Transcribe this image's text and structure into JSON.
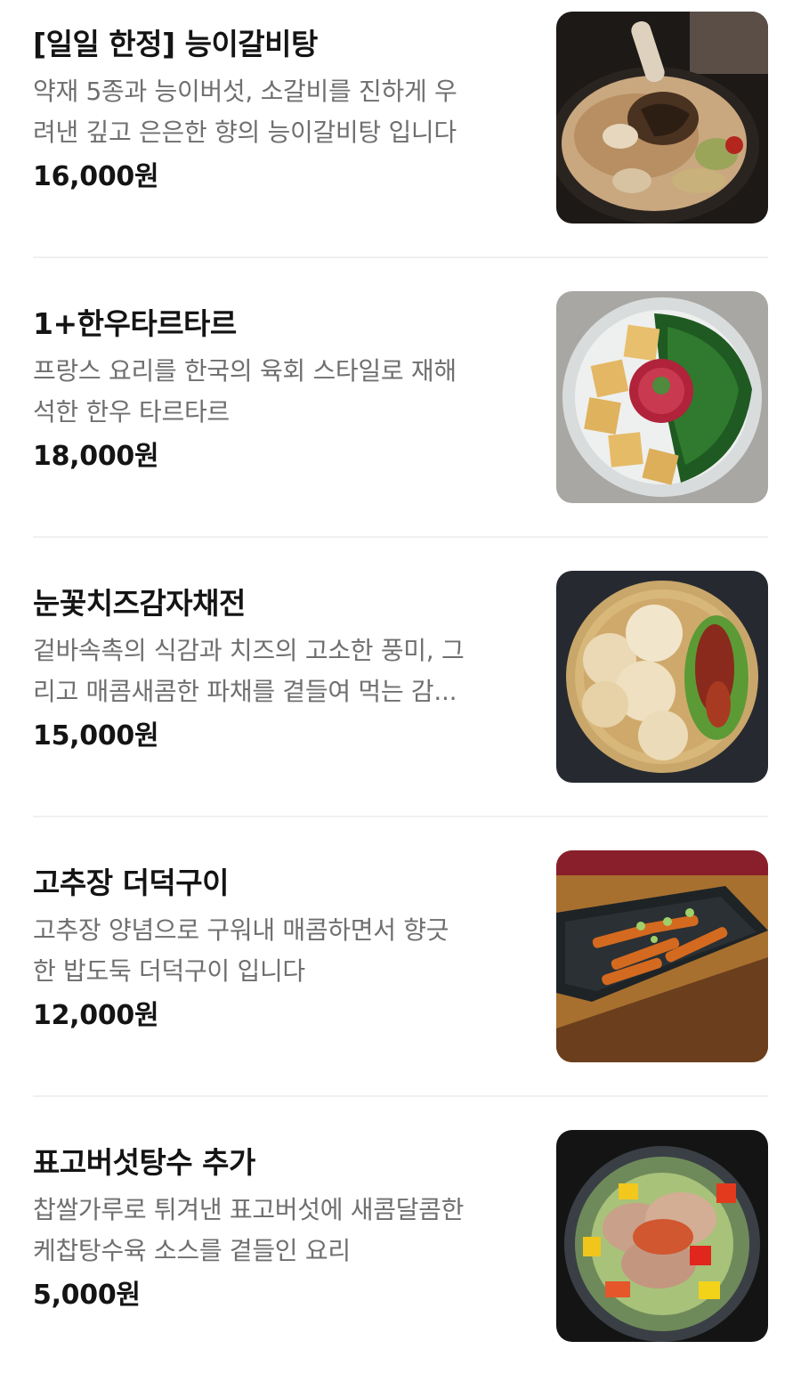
{
  "menu": {
    "items": [
      {
        "name": "[일일 한정] 능이갈비탕",
        "desc_lines": [
          "약재 5종과 능이버섯, 소갈비를 진하게 우",
          "려낸 깊고 은은한 향의 능이갈비탕 입니다"
        ],
        "price": "16,000원",
        "photo": "beef-rib-soup-photo"
      },
      {
        "name": "1+한우타르타르",
        "desc_lines": [
          "프랑스 요리를 한국의 육회 스타일로 재해",
          "석한 한우 타르타르"
        ],
        "price": "18,000원",
        "photo": "beef-tartare-photo"
      },
      {
        "name": "눈꽃치즈감자채전",
        "desc_lines": [
          "겉바속촉의 식감과 치즈의 고소한 풍미, 그",
          "리고 매콤새콤한 파채를 곁들여 먹는 감..."
        ],
        "price": "15,000원",
        "photo": "cheese-potato-pancake-photo"
      },
      {
        "name": "고추장 더덕구이",
        "desc_lines": [
          "고추장 양념으로 구워내 매콤하면서 향긋",
          "한 밥도둑 더덕구이 입니다"
        ],
        "price": "12,000원",
        "photo": "grilled-deodeok-photo"
      },
      {
        "name": "표고버섯탕수 추가",
        "desc_lines": [
          "찹쌀가루로 튀겨낸 표고버섯에 새콤달콤한",
          "케찹탕수육 소스를 곁들인 요리"
        ],
        "price": "5,000원",
        "photo": "shiitake-sweet-sour-photo"
      }
    ]
  },
  "colors": {
    "title": "#141414",
    "description": "#6f6f6f",
    "divider": "#f0f0f0"
  }
}
